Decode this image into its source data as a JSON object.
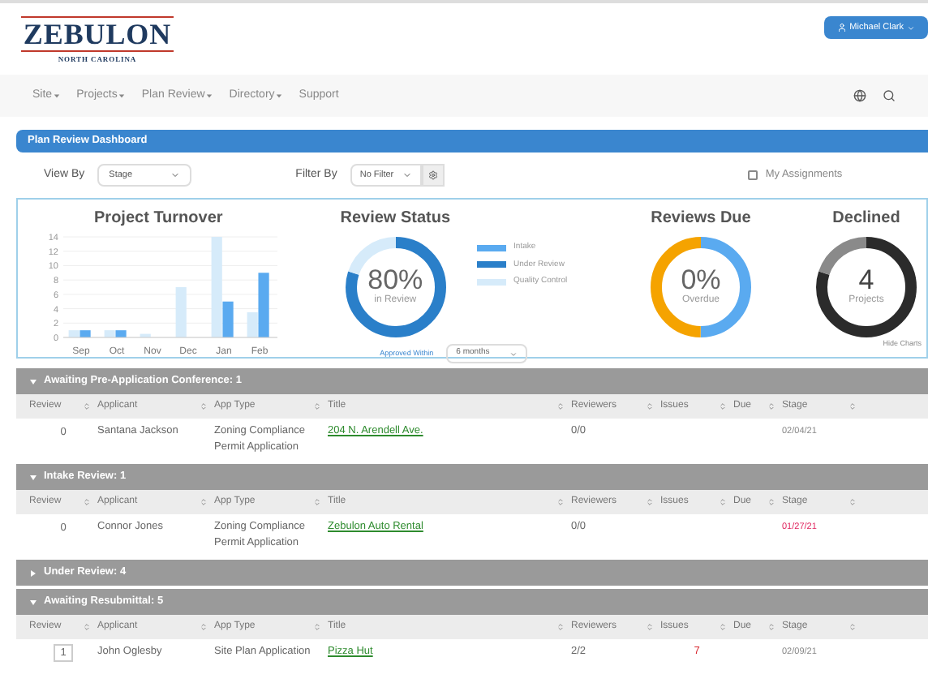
{
  "header": {
    "logo": {
      "name": "ZEBULON",
      "subtitle": "NORTH CAROLINA"
    },
    "user_button": "Michael Clark"
  },
  "nav": [
    {
      "label": "Site",
      "has_menu": true
    },
    {
      "label": "Projects",
      "has_menu": true
    },
    {
      "label": "Plan Review",
      "has_menu": true
    },
    {
      "label": "Directory",
      "has_menu": true
    },
    {
      "label": "Support",
      "has_menu": false
    }
  ],
  "panel_title": "Plan Review Dashboard",
  "filters": {
    "view_by": {
      "label": "View By",
      "value": "Stage"
    },
    "filter_by": {
      "label": "Filter By",
      "value": "No Filter"
    },
    "my_assignments": {
      "label": "My Assignments",
      "checked": false
    }
  },
  "charts": {
    "turnover": {
      "chart_data": {
        "type": "bar",
        "title": "Project Turnover",
        "categories": [
          "Sep",
          "Oct",
          "Nov",
          "Dec",
          "Jan",
          "Feb"
        ],
        "yticks": [
          0,
          2,
          4,
          6,
          8,
          10,
          12,
          14
        ],
        "ylim": [
          0,
          14
        ],
        "grid": true,
        "series": [
          {
            "color": "#d6ebfa",
            "values": [
              1,
              1,
              0.5,
              7,
              14,
              3.5
            ]
          },
          {
            "color": "#5aaaf0",
            "values": [
              1,
              1,
              0,
              0,
              5,
              9
            ]
          }
        ]
      }
    },
    "review_status": {
      "title": "Review Status",
      "value": "80%",
      "caption": "in Review",
      "legend": [
        {
          "label": "Intake",
          "color": "#5aaaf0"
        },
        {
          "label": "Under Review",
          "color": "#2a7fc9"
        },
        {
          "label": "Quality Control",
          "color": "#d6ebfa"
        }
      ],
      "approved_within": {
        "label": "Approved Within",
        "value": "6 months"
      }
    },
    "reviews_due": {
      "title": "Reviews Due",
      "value": "0%",
      "caption": "Overdue"
    },
    "declined": {
      "title": "Declined",
      "value": "4",
      "caption": "Projects"
    },
    "hide_link": "Hide Charts"
  },
  "groups": [
    {
      "title": "Awaiting Pre-Application Conference: 1",
      "expanded": true,
      "columns": [
        "Review",
        "Applicant",
        "App Type",
        "Title",
        "Reviewers",
        "Issues",
        "Due",
        "Stage"
      ],
      "rows": [
        {
          "review": "0",
          "boxed": false,
          "applicant": "Santana Jackson",
          "app_type": "Zoning Compliance Permit Application",
          "title": "204 N. Arendell Ave.",
          "reviewers": "0/0",
          "stage": "02/04/21",
          "overdue": false
        }
      ]
    },
    {
      "title": "Intake Review: 1",
      "expanded": true,
      "columns": [
        "Review",
        "Applicant",
        "App Type",
        "Title",
        "Reviewers",
        "Issues",
        "Due",
        "Stage"
      ],
      "rows": [
        {
          "review": "0",
          "boxed": false,
          "applicant": "Connor Jones",
          "app_type": "Zoning Compliance Permit Application",
          "title": "Zebulon Auto Rental",
          "reviewers": "0/0",
          "stage": "01/27/21",
          "overdue": true
        }
      ]
    },
    {
      "title": "Under Review: 4",
      "expanded": false
    },
    {
      "title": "Awaiting Resubmittal: 5",
      "expanded": true,
      "columns": [
        "Review",
        "Applicant",
        "App Type",
        "Title",
        "Reviewers",
        "Issues",
        "Due",
        "Stage"
      ],
      "rows": [
        {
          "review": "1",
          "boxed": true,
          "applicant": "John Oglesby",
          "app_type": "Site Plan Application",
          "title": "Pizza Hut",
          "reviewers": "2/2",
          "issues": "7",
          "stage": "02/09/21",
          "overdue": false
        }
      ]
    }
  ]
}
